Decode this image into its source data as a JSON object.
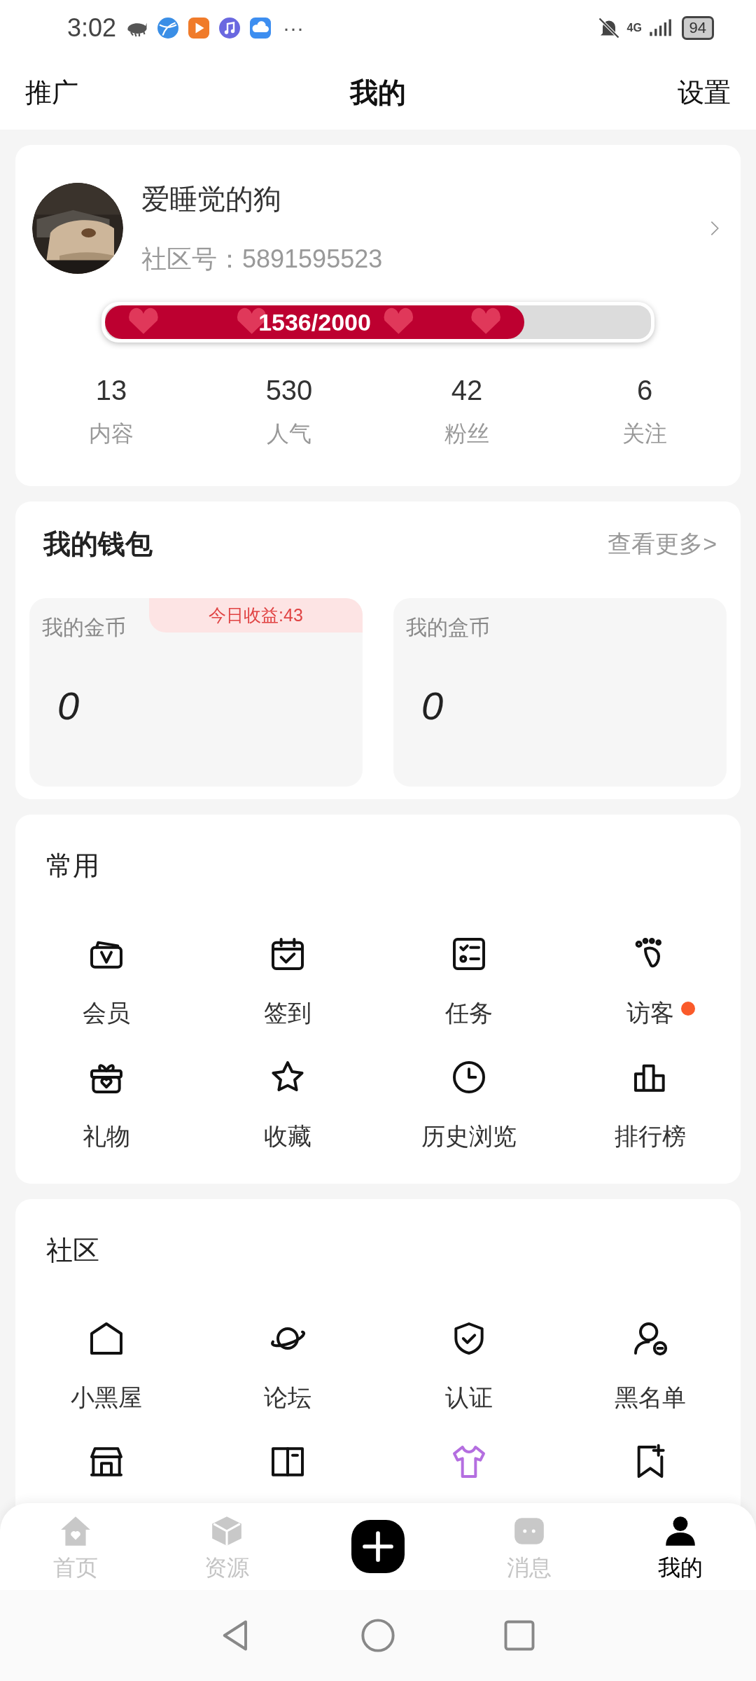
{
  "status_bar": {
    "time": "3:02",
    "more": "···",
    "network": "4G",
    "battery": "94"
  },
  "header": {
    "left": "推广",
    "title": "我的",
    "right": "设置"
  },
  "profile": {
    "name": "爱睡觉的狗",
    "id_text": "社区号：5891595523",
    "progress": {
      "text": "1536/2000",
      "level": 0.768
    },
    "stats": [
      {
        "value": "13",
        "label": "内容"
      },
      {
        "value": "530",
        "label": "人气"
      },
      {
        "value": "42",
        "label": "粉丝"
      },
      {
        "value": "6",
        "label": "关注"
      }
    ]
  },
  "wallet": {
    "title": "我的钱包",
    "more": "查看更多>",
    "accounts": [
      {
        "label": "我的金币",
        "value": "0",
        "badge": "今日收益:43"
      },
      {
        "label": "我的盒币",
        "value": "0"
      }
    ]
  },
  "sections": [
    {
      "title": "常用",
      "items": [
        {
          "label": "会员",
          "dot": false
        },
        {
          "label": "签到",
          "dot": false
        },
        {
          "label": "任务",
          "dot": false
        },
        {
          "label": "访客",
          "dot": true
        },
        {
          "label": "礼物",
          "dot": false
        },
        {
          "label": "收藏",
          "dot": false
        },
        {
          "label": "历史浏览",
          "dot": false
        },
        {
          "label": "排行榜",
          "dot": false
        }
      ]
    },
    {
      "title": "社区",
      "items": [
        {
          "label": "小黑屋",
          "dot": false
        },
        {
          "label": "论坛",
          "dot": false
        },
        {
          "label": "认证",
          "dot": false
        },
        {
          "label": "黑名单",
          "dot": false
        },
        {
          "dot": false
        },
        {
          "dot": false
        },
        {
          "dot": false
        },
        {
          "dot": false
        }
      ]
    }
  ],
  "tab_bar": [
    {
      "kind": "tab",
      "label": "首页",
      "selected": false
    },
    {
      "kind": "tab",
      "label": "资源",
      "selected": false
    },
    {
      "kind": "add"
    },
    {
      "kind": "tab",
      "label": "消息",
      "selected": false
    },
    {
      "kind": "tab",
      "label": "我的",
      "selected": true
    }
  ]
}
